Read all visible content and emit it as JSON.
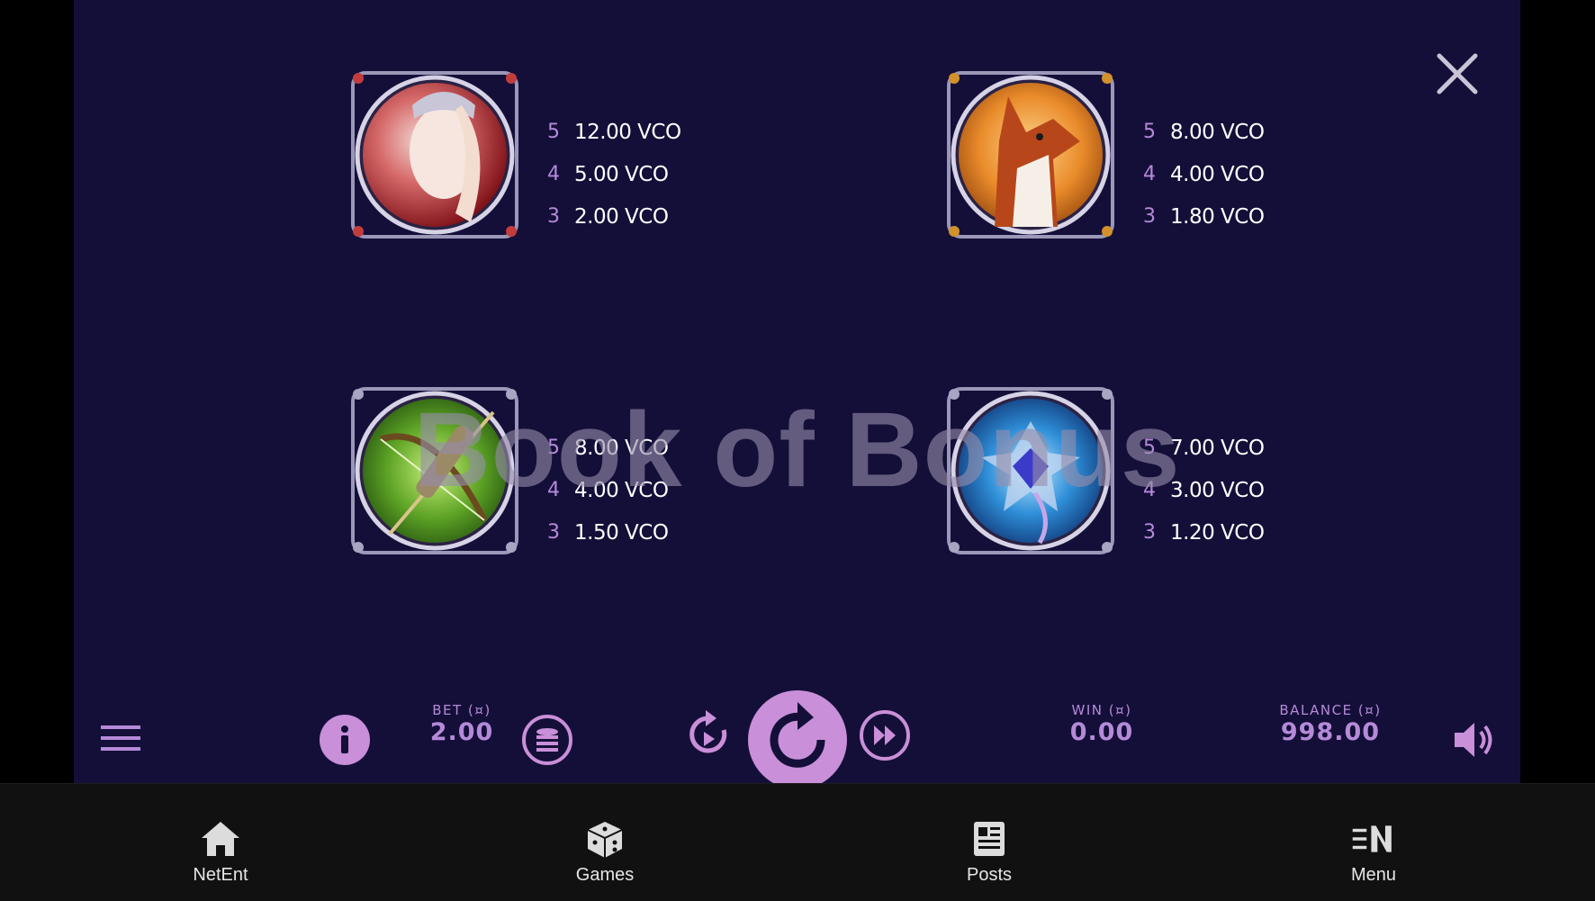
{
  "paytable": {
    "symbols": [
      {
        "name": "elf-woman",
        "pays": [
          {
            "count": "5",
            "value": "12.00 VCO"
          },
          {
            "count": "4",
            "value": "5.00 VCO"
          },
          {
            "count": "3",
            "value": "2.00 VCO"
          }
        ]
      },
      {
        "name": "fox",
        "pays": [
          {
            "count": "5",
            "value": "8.00 VCO"
          },
          {
            "count": "4",
            "value": "4.00 VCO"
          },
          {
            "count": "3",
            "value": "1.80 VCO"
          }
        ]
      },
      {
        "name": "bow-and-arrows",
        "pays": [
          {
            "count": "5",
            "value": "8.00 VCO"
          },
          {
            "count": "4",
            "value": "4.00 VCO"
          },
          {
            "count": "3",
            "value": "1.50 VCO"
          }
        ]
      },
      {
        "name": "blue-gem",
        "pays": [
          {
            "count": "5",
            "value": "7.00 VCO"
          },
          {
            "count": "4",
            "value": "3.00 VCO"
          },
          {
            "count": "3",
            "value": "1.20 VCO"
          }
        ]
      }
    ]
  },
  "watermark": "Book of Bonus",
  "controls": {
    "bet_label": "BET (¤)",
    "bet_value": "2.00",
    "win_label": "WIN (¤)",
    "win_value": "0.00",
    "balance_label": "BALANCE (¤)",
    "balance_value": "998.00"
  },
  "bottom_nav": {
    "items": [
      {
        "label": "NetEnt",
        "icon": "home-icon"
      },
      {
        "label": "Games",
        "icon": "dice-icon"
      },
      {
        "label": "Posts",
        "icon": "newspaper-icon"
      },
      {
        "label": "Menu",
        "icon": "menu-icon"
      }
    ]
  },
  "colors": {
    "background": "#140f39",
    "accent": "#b58ad8",
    "spin_button": "#c98fd8",
    "nav_background": "#111111"
  }
}
